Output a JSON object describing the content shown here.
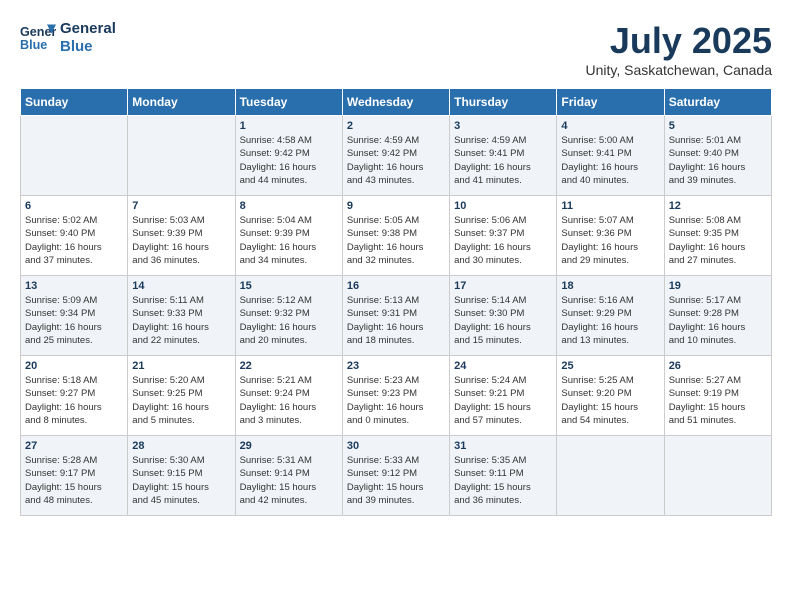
{
  "header": {
    "logo_line1": "General",
    "logo_line2": "Blue",
    "month_year": "July 2025",
    "location": "Unity, Saskatchewan, Canada"
  },
  "days_of_week": [
    "Sunday",
    "Monday",
    "Tuesday",
    "Wednesday",
    "Thursday",
    "Friday",
    "Saturday"
  ],
  "weeks": [
    [
      {
        "day": "",
        "info": ""
      },
      {
        "day": "",
        "info": ""
      },
      {
        "day": "1",
        "info": "Sunrise: 4:58 AM\nSunset: 9:42 PM\nDaylight: 16 hours\nand 44 minutes."
      },
      {
        "day": "2",
        "info": "Sunrise: 4:59 AM\nSunset: 9:42 PM\nDaylight: 16 hours\nand 43 minutes."
      },
      {
        "day": "3",
        "info": "Sunrise: 4:59 AM\nSunset: 9:41 PM\nDaylight: 16 hours\nand 41 minutes."
      },
      {
        "day": "4",
        "info": "Sunrise: 5:00 AM\nSunset: 9:41 PM\nDaylight: 16 hours\nand 40 minutes."
      },
      {
        "day": "5",
        "info": "Sunrise: 5:01 AM\nSunset: 9:40 PM\nDaylight: 16 hours\nand 39 minutes."
      }
    ],
    [
      {
        "day": "6",
        "info": "Sunrise: 5:02 AM\nSunset: 9:40 PM\nDaylight: 16 hours\nand 37 minutes."
      },
      {
        "day": "7",
        "info": "Sunrise: 5:03 AM\nSunset: 9:39 PM\nDaylight: 16 hours\nand 36 minutes."
      },
      {
        "day": "8",
        "info": "Sunrise: 5:04 AM\nSunset: 9:39 PM\nDaylight: 16 hours\nand 34 minutes."
      },
      {
        "day": "9",
        "info": "Sunrise: 5:05 AM\nSunset: 9:38 PM\nDaylight: 16 hours\nand 32 minutes."
      },
      {
        "day": "10",
        "info": "Sunrise: 5:06 AM\nSunset: 9:37 PM\nDaylight: 16 hours\nand 30 minutes."
      },
      {
        "day": "11",
        "info": "Sunrise: 5:07 AM\nSunset: 9:36 PM\nDaylight: 16 hours\nand 29 minutes."
      },
      {
        "day": "12",
        "info": "Sunrise: 5:08 AM\nSunset: 9:35 PM\nDaylight: 16 hours\nand 27 minutes."
      }
    ],
    [
      {
        "day": "13",
        "info": "Sunrise: 5:09 AM\nSunset: 9:34 PM\nDaylight: 16 hours\nand 25 minutes."
      },
      {
        "day": "14",
        "info": "Sunrise: 5:11 AM\nSunset: 9:33 PM\nDaylight: 16 hours\nand 22 minutes."
      },
      {
        "day": "15",
        "info": "Sunrise: 5:12 AM\nSunset: 9:32 PM\nDaylight: 16 hours\nand 20 minutes."
      },
      {
        "day": "16",
        "info": "Sunrise: 5:13 AM\nSunset: 9:31 PM\nDaylight: 16 hours\nand 18 minutes."
      },
      {
        "day": "17",
        "info": "Sunrise: 5:14 AM\nSunset: 9:30 PM\nDaylight: 16 hours\nand 15 minutes."
      },
      {
        "day": "18",
        "info": "Sunrise: 5:16 AM\nSunset: 9:29 PM\nDaylight: 16 hours\nand 13 minutes."
      },
      {
        "day": "19",
        "info": "Sunrise: 5:17 AM\nSunset: 9:28 PM\nDaylight: 16 hours\nand 10 minutes."
      }
    ],
    [
      {
        "day": "20",
        "info": "Sunrise: 5:18 AM\nSunset: 9:27 PM\nDaylight: 16 hours\nand 8 minutes."
      },
      {
        "day": "21",
        "info": "Sunrise: 5:20 AM\nSunset: 9:25 PM\nDaylight: 16 hours\nand 5 minutes."
      },
      {
        "day": "22",
        "info": "Sunrise: 5:21 AM\nSunset: 9:24 PM\nDaylight: 16 hours\nand 3 minutes."
      },
      {
        "day": "23",
        "info": "Sunrise: 5:23 AM\nSunset: 9:23 PM\nDaylight: 16 hours\nand 0 minutes."
      },
      {
        "day": "24",
        "info": "Sunrise: 5:24 AM\nSunset: 9:21 PM\nDaylight: 15 hours\nand 57 minutes."
      },
      {
        "day": "25",
        "info": "Sunrise: 5:25 AM\nSunset: 9:20 PM\nDaylight: 15 hours\nand 54 minutes."
      },
      {
        "day": "26",
        "info": "Sunrise: 5:27 AM\nSunset: 9:19 PM\nDaylight: 15 hours\nand 51 minutes."
      }
    ],
    [
      {
        "day": "27",
        "info": "Sunrise: 5:28 AM\nSunset: 9:17 PM\nDaylight: 15 hours\nand 48 minutes."
      },
      {
        "day": "28",
        "info": "Sunrise: 5:30 AM\nSunset: 9:15 PM\nDaylight: 15 hours\nand 45 minutes."
      },
      {
        "day": "29",
        "info": "Sunrise: 5:31 AM\nSunset: 9:14 PM\nDaylight: 15 hours\nand 42 minutes."
      },
      {
        "day": "30",
        "info": "Sunrise: 5:33 AM\nSunset: 9:12 PM\nDaylight: 15 hours\nand 39 minutes."
      },
      {
        "day": "31",
        "info": "Sunrise: 5:35 AM\nSunset: 9:11 PM\nDaylight: 15 hours\nand 36 minutes."
      },
      {
        "day": "",
        "info": ""
      },
      {
        "day": "",
        "info": ""
      }
    ]
  ]
}
